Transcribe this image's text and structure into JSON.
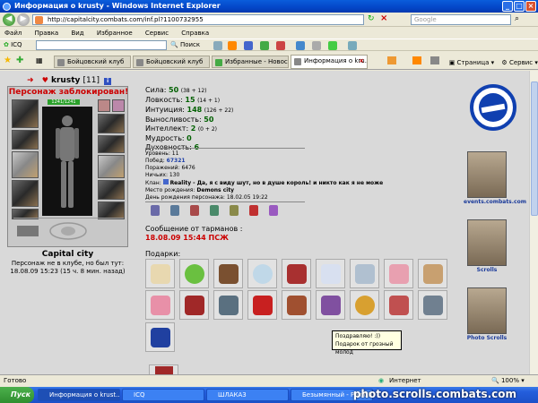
{
  "window": {
    "title": "Информация о krusty - Windows Internet Explorer"
  },
  "address": {
    "url": "http://capitalcity.combats.com/inf.pl?1100732955",
    "search_placeholder": "Google"
  },
  "menu": [
    "Файл",
    "Правка",
    "Вид",
    "Избранное",
    "Сервис",
    "Справка"
  ],
  "toolbar": {
    "icq": "ICQ",
    "search": "Поиск"
  },
  "tabs": [
    {
      "label": "Бойцовский клуб",
      "active": false
    },
    {
      "label": "Бойцовский клуб",
      "active": false
    },
    {
      "label": "Избранные - Новости",
      "active": false
    },
    {
      "label": "Информация о kru...",
      "active": true
    }
  ],
  "commands": {
    "page": "Страница",
    "service": "Сервис"
  },
  "character": {
    "arrow": "➜",
    "name": "krusty",
    "level": "[11]",
    "info_icon": "i",
    "blocked": "Персонаж заблокирован!",
    "hp": "1241/1241",
    "city": "Capital city",
    "not_in_club": "Персонаж не в клубе, но был тут:",
    "last_seen": "18.08.09 15:23 (15 ч. 8 мин. назад)"
  },
  "stats": {
    "strength_label": "Сила:",
    "strength": "50",
    "strength_extra": "(38 + 12)",
    "agility_label": "Ловкость:",
    "agility": "15",
    "agility_extra": "(14 + 1)",
    "intuition_label": "Интуиция:",
    "intuition": "148",
    "intuition_extra": "(126 + 22)",
    "endurance_label": "Выносливость:",
    "endurance": "50",
    "intellect_label": "Интеллект:",
    "intellect": "2",
    "intellect_extra": "(0 + 2)",
    "wisdom_label": "Мудрость:",
    "wisdom": "0",
    "spirit_label": "Духовность:",
    "spirit": "6"
  },
  "info": {
    "level_label": "Уровень:",
    "level": "11",
    "wins_label": "Побед:",
    "wins": "67321",
    "losses_label": "Поражений:",
    "losses": "6476",
    "draws_label": "Ничьих:",
    "draws": "130",
    "clan_label": "Клан:",
    "clan": "Reality",
    "clan_motto": "- Да, я с виду шут, но в душе король! и никто как я не може",
    "birthplace_label": "Место рождения:",
    "birthplace": "Demons city",
    "birthday_label": "День рождения персонажа:",
    "birthday": "18.02.05 19:22"
  },
  "messages": {
    "label": "Сообщение от тарманов :",
    "date": "18.08.09 15:44 ПСЖ"
  },
  "gifts": {
    "label": "Подарки:",
    "tooltip_line1": "Поздравляю! :))",
    "tooltip_line2": "Подарок от грозный молод"
  },
  "right_links": {
    "events": "events.combats.com",
    "scrolls": "Scrolls",
    "photo": "Photo Scrolls"
  },
  "status": {
    "left": "Готово",
    "zone": "Интернет",
    "zoom": "100%"
  },
  "taskbar": {
    "start": "Пуск",
    "items": [
      "Информация о krust...",
      "ICQ",
      "ШЛАКА3",
      "Безымянный - Paint.NET..."
    ],
    "watermark": "photo.scrolls.combats.com"
  },
  "colors": {
    "accent": "#1040b0",
    "alert": "#cc0000",
    "stat_green": "#006000"
  }
}
